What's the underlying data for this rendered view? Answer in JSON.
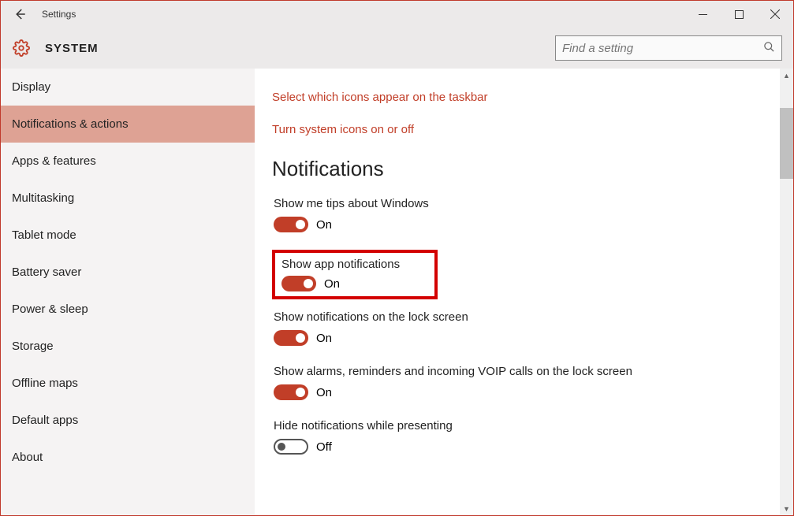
{
  "window": {
    "title": "Settings"
  },
  "header": {
    "system_label": "SYSTEM",
    "search_placeholder": "Find a setting"
  },
  "sidebar": {
    "items": [
      {
        "label": "Display"
      },
      {
        "label": "Notifications & actions"
      },
      {
        "label": "Apps & features"
      },
      {
        "label": "Multitasking"
      },
      {
        "label": "Tablet mode"
      },
      {
        "label": "Battery saver"
      },
      {
        "label": "Power & sleep"
      },
      {
        "label": "Storage"
      },
      {
        "label": "Offline maps"
      },
      {
        "label": "Default apps"
      },
      {
        "label": "About"
      }
    ],
    "active_index": 1
  },
  "main": {
    "links": [
      "Select which icons appear on the taskbar",
      "Turn system icons on or off"
    ],
    "section_header": "Notifications",
    "settings": [
      {
        "label": "Show me tips about Windows",
        "on": true,
        "state": "On",
        "highlighted": false
      },
      {
        "label": "Show app notifications",
        "on": true,
        "state": "On",
        "highlighted": true
      },
      {
        "label": "Show notifications on the lock screen",
        "on": true,
        "state": "On",
        "highlighted": false
      },
      {
        "label": "Show alarms, reminders and incoming VOIP calls on the lock screen",
        "on": true,
        "state": "On",
        "highlighted": false
      },
      {
        "label": "Hide notifications while presenting",
        "on": false,
        "state": "Off",
        "highlighted": false
      }
    ]
  }
}
